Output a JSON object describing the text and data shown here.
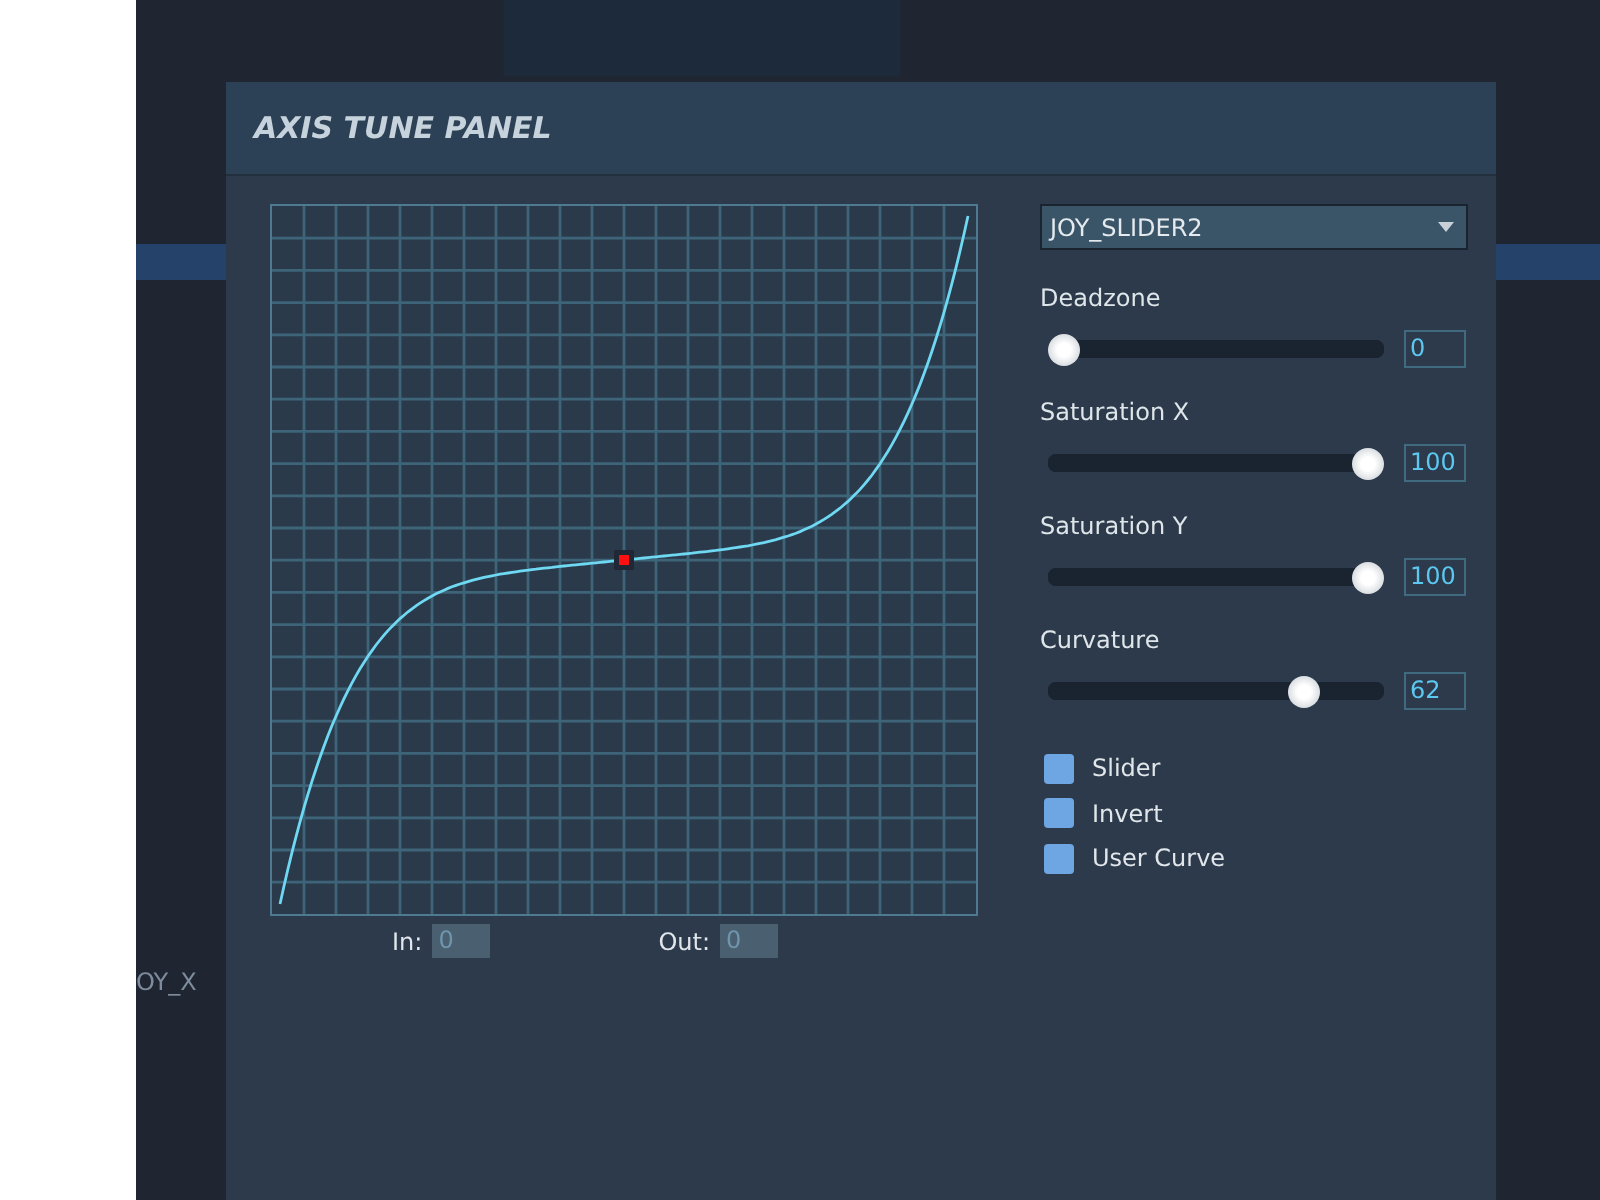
{
  "background": {
    "labels": [
      "OY_X"
    ]
  },
  "panel": {
    "title": "AXIS TUNE PANEL"
  },
  "graph": {
    "in_label": "In:",
    "in_value": "0",
    "out_label": "Out:",
    "out_value": "0"
  },
  "axis_select": {
    "value": "JOY_SLIDER2"
  },
  "sliders": [
    {
      "label": "Deadzone",
      "level": 0,
      "reading": "0"
    },
    {
      "label": "Saturation X",
      "level": 1,
      "reading": "100"
    },
    {
      "label": "Saturation Y",
      "level": 1,
      "reading": "100"
    },
    {
      "label": "Curvature",
      "level": 0.79,
      "reading": "62"
    }
  ],
  "options": [
    {
      "label": "Slider",
      "checked": false
    },
    {
      "label": "Invert",
      "checked": false
    },
    {
      "label": "User Curve",
      "checked": false
    }
  ]
}
